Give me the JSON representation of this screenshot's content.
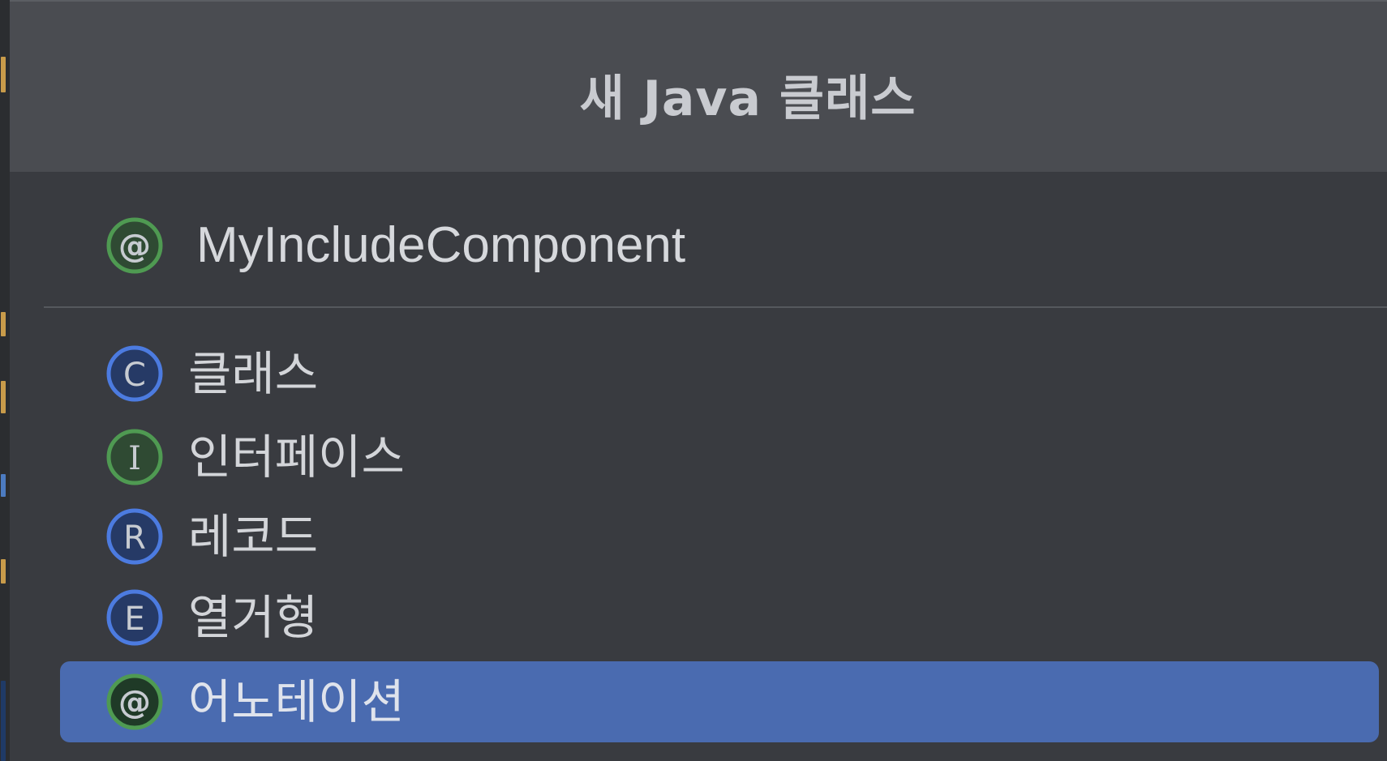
{
  "dialog": {
    "title": "새 Java 클래스"
  },
  "recent": {
    "label": "MyIncludeComponent",
    "icon": "annotation-icon"
  },
  "kinds": [
    {
      "label": "클래스",
      "icon": "class-icon",
      "letter": "C",
      "color": "#4c7be0"
    },
    {
      "label": "인터페이스",
      "icon": "interface-icon",
      "letter": "I",
      "color": "#4f9a52"
    },
    {
      "label": "레코드",
      "icon": "record-icon",
      "letter": "R",
      "color": "#4c7be0"
    },
    {
      "label": "열거형",
      "icon": "enum-icon",
      "letter": "E",
      "color": "#4c7be0"
    },
    {
      "label": "어노테이션",
      "icon": "annotation-icon",
      "letter": "@",
      "color": "#4f9a52",
      "selected": true
    }
  ],
  "colors": {
    "selection": "#4a6bb0",
    "header": "#4a4c51",
    "list_background": "#393b40"
  }
}
